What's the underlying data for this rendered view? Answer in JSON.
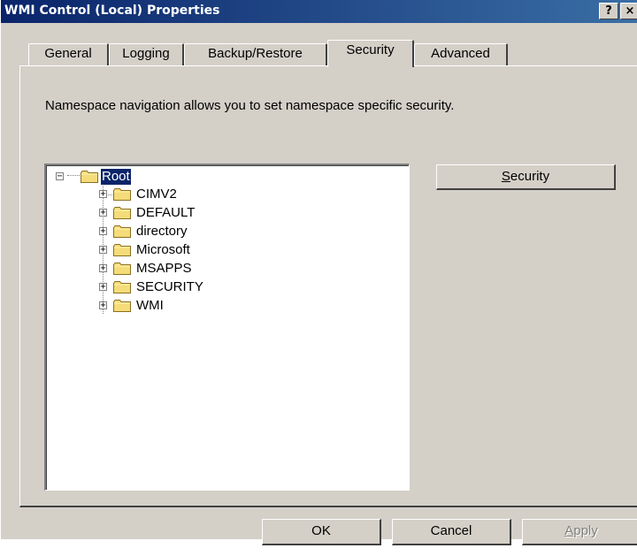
{
  "window": {
    "title": "WMI Control (Local) Properties",
    "help_label": "?",
    "close_label": "×"
  },
  "tabs": [
    {
      "label": "General",
      "active": false
    },
    {
      "label": "Logging",
      "active": false
    },
    {
      "label": "Backup/Restore",
      "active": false
    },
    {
      "label": "Security",
      "active": true
    },
    {
      "label": "Advanced",
      "active": false
    }
  ],
  "security_tab": {
    "description": "Namespace navigation allows you to set namespace specific security.",
    "security_button": {
      "prefix": "",
      "mnemonic": "S",
      "rest": "ecurity"
    },
    "tree": {
      "root": {
        "label": "Root",
        "expanded": true,
        "selected": true,
        "icon": "folder-icon"
      },
      "children": [
        {
          "label": "CIMV2",
          "expanded": false,
          "icon": "folder-icon"
        },
        {
          "label": "DEFAULT",
          "expanded": false,
          "icon": "folder-icon"
        },
        {
          "label": "directory",
          "expanded": false,
          "icon": "folder-icon"
        },
        {
          "label": "Microsoft",
          "expanded": false,
          "icon": "folder-icon"
        },
        {
          "label": "MSAPPS",
          "expanded": false,
          "icon": "folder-icon"
        },
        {
          "label": "SECURITY",
          "expanded": false,
          "icon": "folder-icon"
        },
        {
          "label": "WMI",
          "expanded": false,
          "icon": "folder-icon"
        }
      ]
    }
  },
  "footer": {
    "ok_label": "OK",
    "cancel_label": "Cancel",
    "apply": {
      "mnemonic": "A",
      "rest": "pply",
      "enabled": false
    }
  },
  "colors": {
    "titlebar_start": "#0a246a",
    "titlebar_end": "#3a6ea5",
    "face": "#d4d0c8",
    "selection": "#0a246a",
    "folder": "#f5dc7a"
  }
}
